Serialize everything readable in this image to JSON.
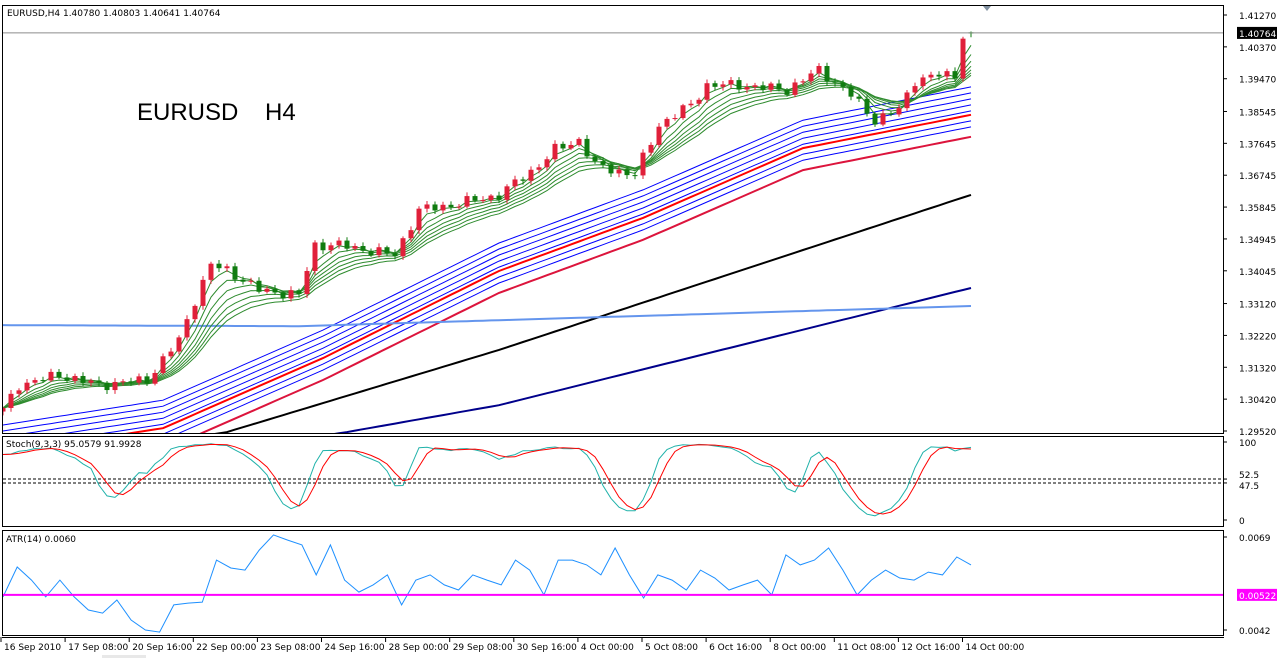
{
  "header": {
    "title": "EURUSD,H4  1.40780 1.40803 1.40641 1.40764"
  },
  "overlay_label": "EURUSD    H4",
  "colors": {
    "bull": "#e0203a",
    "bear": "#107c10",
    "green_ma": "#2e8b2e",
    "blue_ma": "#0000ff",
    "red_ma": "#ff0000",
    "red_ma2": "#dc143c",
    "black_ma": "#000000",
    "navy_ma": "#00008b",
    "lightblue_ma": "#6495ed",
    "stoch_k": "#20b2aa",
    "stoch_d": "#ff0000",
    "atr": "#1e90ff",
    "atr_level": "#ff00ff"
  },
  "chart_data": [
    {
      "type": "candlestick",
      "symbol": "EURUSD",
      "timeframe": "H4",
      "ohlc_last": {
        "open": 1.4078,
        "high": 1.40803,
        "low": 1.40641,
        "close": 1.40764
      },
      "current_price_label": "1.40764",
      "ylim": [
        1.2952,
        1.4127
      ],
      "y_ticks": [
        "1.41270",
        "1.40370",
        "1.39470",
        "1.38545",
        "1.37645",
        "1.36745",
        "1.35845",
        "1.34945",
        "1.34045",
        "1.33120",
        "1.32220",
        "1.31320",
        "1.30420",
        "1.29520"
      ],
      "bar_count": 122,
      "close_path": [
        [
          0,
          1.3011
        ],
        [
          2,
          1.3082
        ],
        [
          7,
          1.311
        ],
        [
          12,
          1.3082
        ],
        [
          18,
          1.3096
        ],
        [
          22,
          1.3209
        ],
        [
          24,
          1.3322
        ],
        [
          26,
          1.3421
        ],
        [
          28,
          1.3407
        ],
        [
          32,
          1.335
        ],
        [
          37,
          1.3336
        ],
        [
          39,
          1.3477
        ],
        [
          42,
          1.3477
        ],
        [
          49,
          1.3449
        ],
        [
          52,
          1.3576
        ],
        [
          56,
          1.359
        ],
        [
          62,
          1.3618
        ],
        [
          67,
          1.3703
        ],
        [
          69,
          1.3746
        ],
        [
          72,
          1.3774
        ],
        [
          74,
          1.3703
        ],
        [
          79,
          1.3675
        ],
        [
          82,
          1.3816
        ],
        [
          86,
          1.3873
        ],
        [
          88,
          1.3929
        ],
        [
          92,
          1.3929
        ],
        [
          98,
          1.3915
        ],
        [
          102,
          1.3972
        ],
        [
          106,
          1.3901
        ],
        [
          109,
          1.383
        ],
        [
          112,
          1.3859
        ],
        [
          114,
          1.3943
        ],
        [
          117,
          1.3957
        ],
        [
          119,
          1.3957
        ],
        [
          120,
          1.407
        ],
        [
          121,
          1.40764
        ]
      ],
      "green_ema_periods": [
        3,
        5,
        7,
        9,
        11,
        13,
        15
      ],
      "lines": [
        {
          "name": "blue-ma-1",
          "color": "blue_ma",
          "points": [
            [
              0,
              1.2969
            ],
            [
              20,
              1.3039
            ],
            [
              40,
              1.3237
            ],
            [
              62,
              1.3483
            ],
            [
              80,
              1.3633
            ],
            [
              100,
              1.383
            ],
            [
              121,
              1.3924
            ]
          ]
        },
        {
          "name": "blue-ma-2",
          "color": "blue_ma",
          "points": [
            [
              0,
              1.2952
            ],
            [
              20,
              1.3022
            ],
            [
              40,
              1.322
            ],
            [
              62,
              1.3466
            ],
            [
              80,
              1.3616
            ],
            [
              100,
              1.3813
            ],
            [
              121,
              1.3907
            ]
          ]
        },
        {
          "name": "blue-ma-3",
          "color": "blue_ma",
          "points": [
            [
              0,
              1.2935
            ],
            [
              20,
              1.3005
            ],
            [
              40,
              1.3203
            ],
            [
              62,
              1.3449
            ],
            [
              80,
              1.3599
            ],
            [
              100,
              1.3796
            ],
            [
              121,
              1.389
            ]
          ]
        },
        {
          "name": "blue-ma-4",
          "color": "blue_ma",
          "points": [
            [
              0,
              1.2918
            ],
            [
              20,
              1.2988
            ],
            [
              40,
              1.3186
            ],
            [
              62,
              1.3432
            ],
            [
              80,
              1.3582
            ],
            [
              100,
              1.3779
            ],
            [
              121,
              1.3873
            ]
          ]
        },
        {
          "name": "blue-ma-5",
          "color": "blue_ma",
          "points": [
            [
              0,
              1.2901
            ],
            [
              20,
              1.2971
            ],
            [
              40,
              1.3169
            ],
            [
              62,
              1.3415
            ],
            [
              80,
              1.3565
            ],
            [
              100,
              1.3762
            ],
            [
              121,
              1.3856
            ]
          ]
        },
        {
          "name": "blue-ma-6",
          "color": "blue_ma",
          "points": [
            [
              0,
              1.2873
            ],
            [
              20,
              1.2943
            ],
            [
              40,
              1.3141
            ],
            [
              62,
              1.3387
            ],
            [
              80,
              1.3537
            ],
            [
              100,
              1.3734
            ],
            [
              121,
              1.3828
            ]
          ]
        },
        {
          "name": "blue-ma-7",
          "color": "blue_ma",
          "points": [
            [
              0,
              1.2856
            ],
            [
              20,
              1.2926
            ],
            [
              40,
              1.3124
            ],
            [
              62,
              1.337
            ],
            [
              80,
              1.352
            ],
            [
              100,
              1.3717
            ],
            [
              121,
              1.3811
            ]
          ]
        },
        {
          "name": "red-ma-1",
          "color": "red_ma",
          "points": [
            [
              0,
              1.289
            ],
            [
              20,
              1.296
            ],
            [
              40,
              1.3158
            ],
            [
              62,
              1.3404
            ],
            [
              80,
              1.3554
            ],
            [
              100,
              1.3751
            ],
            [
              121,
              1.3845
            ]
          ]
        },
        {
          "name": "red-ma-2",
          "color": "red_ma2",
          "points": [
            [
              0,
              1.2828
            ],
            [
              20,
              1.2898
            ],
            [
              40,
              1.3096
            ],
            [
              62,
              1.3342
            ],
            [
              80,
              1.3492
            ],
            [
              100,
              1.3689
            ],
            [
              121,
              1.3783
            ]
          ]
        },
        {
          "name": "black-ma",
          "color": "black_ma",
          "points": [
            [
              0,
              1.285
            ],
            [
              28,
              1.2949
            ],
            [
              62,
              1.3181
            ],
            [
              121,
              1.3619
            ]
          ]
        },
        {
          "name": "navy-ma",
          "color": "navy_ma",
          "points": [
            [
              0,
              1.28
            ],
            [
              43,
              1.2949
            ],
            [
              62,
              1.3025
            ],
            [
              121,
              1.3356
            ]
          ]
        },
        {
          "name": "lightblue-ma",
          "color": "lightblue_ma",
          "points": [
            [
              0,
              1.3251
            ],
            [
              37,
              1.3248
            ],
            [
              121,
              1.3305
            ]
          ]
        }
      ],
      "x_labels": [
        "16 Sep 2010",
        "17 Sep 08:00",
        "20 Sep 16:00",
        "22 Sep 00:00",
        "23 Sep 08:00",
        "24 Sep 16:00",
        "28 Sep 00:00",
        "29 Sep 08:00",
        "30 Sep 16:00",
        "4 Oct 00:00",
        "5 Oct 08:00",
        "6 Oct 16:00",
        "8 Oct 00:00",
        "11 Oct 08:00",
        "12 Oct 16:00",
        "14 Oct 00:00"
      ]
    },
    {
      "type": "line",
      "title": "Stoch(9,3,3) 95.0579 91.9928",
      "params": [
        9,
        3,
        3
      ],
      "ylim": [
        0,
        100
      ],
      "levels": [
        52.5,
        47.5
      ],
      "y_ticks": [
        "100",
        "52.5",
        "47.5",
        "0"
      ]
    },
    {
      "type": "line",
      "title": "ATR(14) 0.0060",
      "ylim": [
        0.0042,
        0.0069
      ],
      "level": 0.00522,
      "level_label": "0.00522",
      "y_ticks": [
        "0.0069",
        "0.0042"
      ],
      "values": [
        0.00516,
        0.00603,
        0.00565,
        0.00516,
        0.00565,
        0.00516,
        0.00478,
        0.00469,
        0.00507,
        0.00449,
        0.0042,
        0.00414,
        0.00493,
        0.00498,
        0.00501,
        0.00623,
        0.006,
        0.00594,
        0.00652,
        0.00696,
        0.00681,
        0.00667,
        0.0058,
        0.00667,
        0.00565,
        0.0053,
        0.00551,
        0.0058,
        0.00493,
        0.00565,
        0.0058,
        0.00551,
        0.00536,
        0.0058,
        0.00565,
        0.00551,
        0.00623,
        0.00594,
        0.00522,
        0.00623,
        0.00623,
        0.00609,
        0.0058,
        0.00658,
        0.0058,
        0.00513,
        0.0058,
        0.00565,
        0.00536,
        0.00594,
        0.00571,
        0.00536,
        0.00551,
        0.00565,
        0.00522,
        0.00638,
        0.00609,
        0.00623,
        0.00658,
        0.00594,
        0.00522,
        0.00565,
        0.00594,
        0.00571,
        0.00565,
        0.00588,
        0.0058,
        0.00632,
        0.00609
      ]
    }
  ]
}
